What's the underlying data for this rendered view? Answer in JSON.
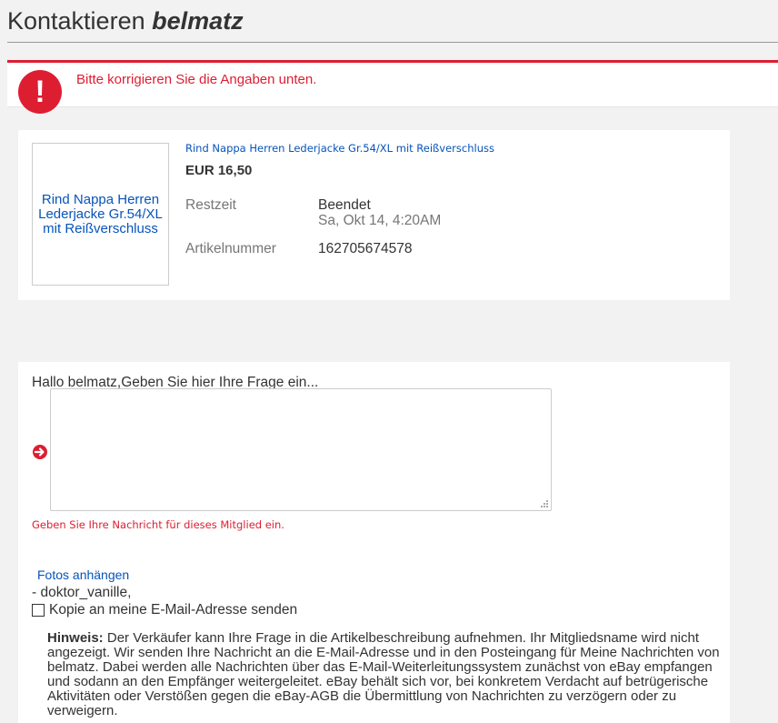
{
  "header": {
    "title_prefix": "Kontaktieren",
    "seller_name": "belmatz"
  },
  "alert": {
    "message": "Bitte korrigieren Sie die Angaben unten.",
    "icon_glyph": "!",
    "color": "#dd1e31"
  },
  "item": {
    "thumbnail_alt": "Rind Nappa Herren Lederjacke Gr.54/XL mit Reißverschluss",
    "title": "Rind Nappa Herren Lederjacke Gr.54/XL mit Reißverschluss",
    "price": "EUR 16,50",
    "time_left_label": "Restzeit",
    "time_left_value": "Beendet",
    "end_date": "Sa, Okt 14, 4:20AM",
    "item_number_label": "Artikelnummer",
    "item_number": "162705674578"
  },
  "message": {
    "prompt": "Hallo belmatz,Geben Sie hier Ihre Frage ein...",
    "value": "",
    "error": "Geben Sie Ihre Nachricht für dieses Mitglied ein.",
    "attach_photos": "Fotos anhängen",
    "signature": "- doktor_vanille,",
    "copy_label": "Kopie an meine E-Mail-Adresse senden",
    "copy_checked": false,
    "note_heading": "Hinweis:",
    "note_text": " Der Verkäufer kann Ihre Frage in die Artikelbeschreibung aufnehmen. Ihr Mitgliedsname wird nicht angezeigt. Wir senden Ihre Nachricht an die E-Mail-Adresse und in den Posteingang für Meine Nachrichten von belmatz. Dabei werden alle Nachrichten über das E-Mail-Weiterleitungssystem zunächst von eBay empfangen und sodann an den Empfänger weitergeleitet. eBay behält sich vor, bei konkretem Verdacht auf betrügerische Aktivitäten oder Verstößen gegen die eBay-AGB die Übermittlung von Nachrichten zu verzögern oder zu verweigern."
  },
  "colors": {
    "link": "#0654ba",
    "error": "#dd1e31",
    "muted": "#767676"
  }
}
